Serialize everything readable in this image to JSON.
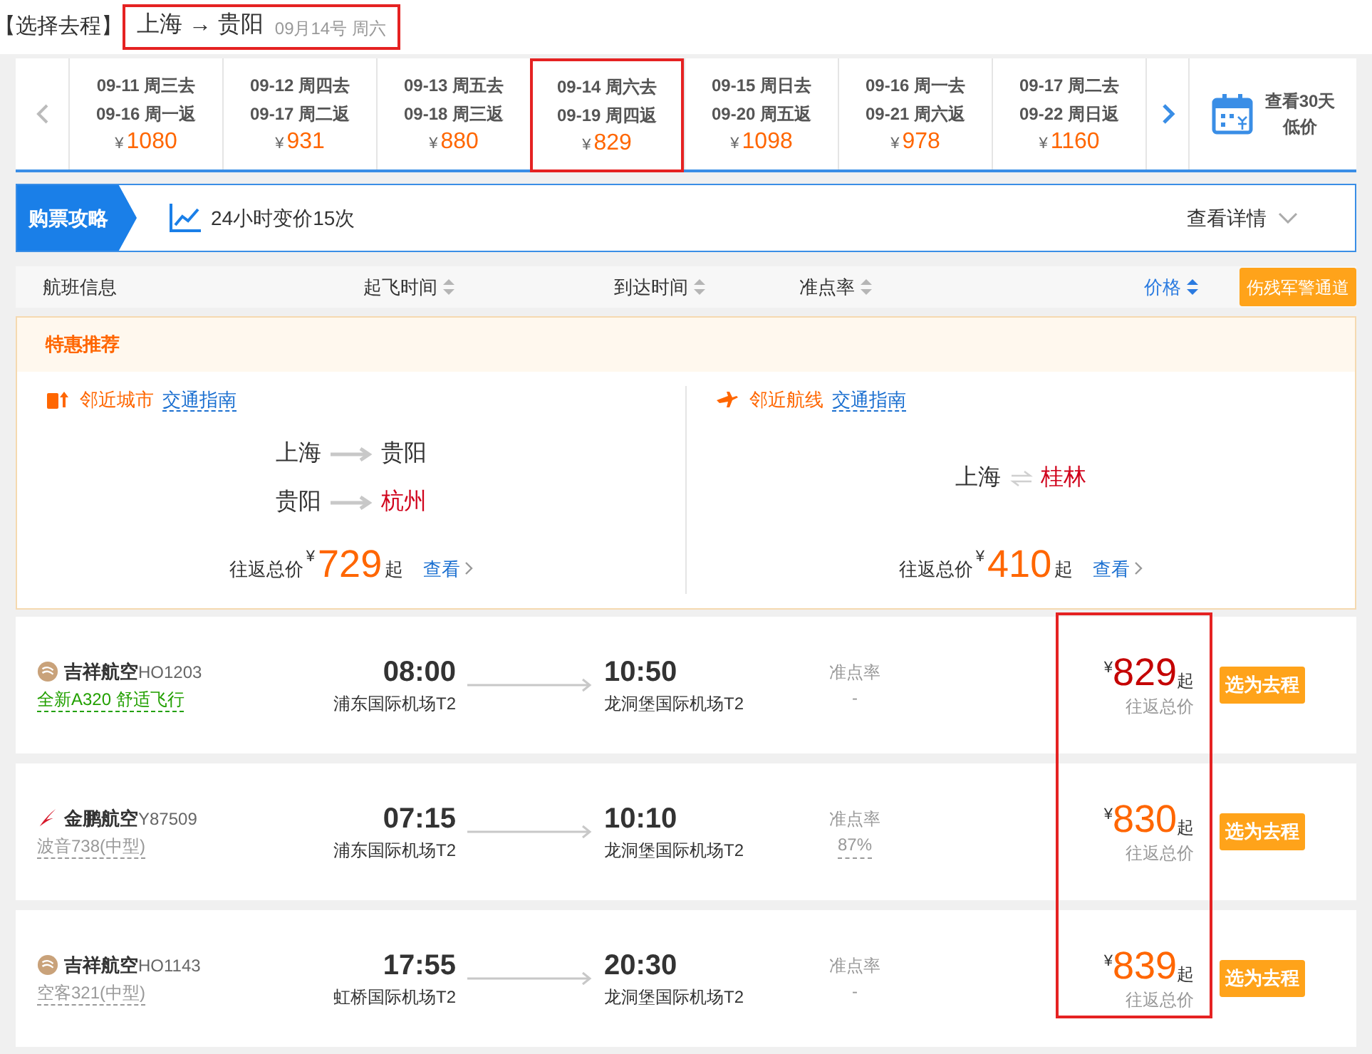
{
  "header": {
    "bracket_title": "【选择去程】",
    "route": "上海 → 贵阳",
    "date": "09月14号 周六"
  },
  "date_tabs": [
    {
      "depart": "09-11 周三去",
      "return": "09-16 周一返",
      "currency": "¥",
      "price": "1080",
      "selected": false
    },
    {
      "depart": "09-12 周四去",
      "return": "09-17 周二返",
      "currency": "¥",
      "price": "931",
      "selected": false
    },
    {
      "depart": "09-13 周五去",
      "return": "09-18 周三返",
      "currency": "¥",
      "price": "880",
      "selected": false
    },
    {
      "depart": "09-14 周六去",
      "return": "09-19 周四返",
      "currency": "¥",
      "price": "829",
      "selected": true
    },
    {
      "depart": "09-15 周日去",
      "return": "09-20 周五返",
      "currency": "¥",
      "price": "1098",
      "selected": false
    },
    {
      "depart": "09-16 周一去",
      "return": "09-21 周六返",
      "currency": "¥",
      "price": "978",
      "selected": false
    },
    {
      "depart": "09-17 周二去",
      "return": "09-22 周日返",
      "currency": "¥",
      "price": "1160",
      "selected": false
    }
  ],
  "calendar_link": [
    "查看30天",
    "低价"
  ],
  "guide": {
    "label": "购票攻略",
    "trend": "24小时变价15次",
    "details": "查看详情"
  },
  "sort_header": {
    "columns": [
      {
        "label": "航班信息",
        "sortable": false,
        "selected": false
      },
      {
        "label": "起飞时间",
        "sortable": true,
        "selected": false
      },
      {
        "label": "到达时间",
        "sortable": true,
        "selected": false
      },
      {
        "label": "准点率",
        "sortable": true,
        "selected": false
      },
      {
        "label": "价格",
        "sortable": true,
        "selected": true
      }
    ],
    "button": "伤残军警通道"
  },
  "recommend": {
    "title": "特惠推荐",
    "cards": [
      {
        "kind": "city",
        "tag": "邻近城市",
        "link": "交通指南",
        "routes": [
          {
            "from": "上海",
            "to": "贵阳",
            "to_highlight": false
          },
          {
            "from": "贵阳",
            "to": "杭州",
            "to_highlight": true
          }
        ],
        "price_label": "往返总价",
        "currency": "¥",
        "price": "729",
        "suffix": "起",
        "view": "查看"
      },
      {
        "kind": "route",
        "tag": "邻近航线",
        "link": "交通指南",
        "routes": [
          {
            "from": "上海",
            "to": "桂林",
            "to_highlight": true
          }
        ],
        "price_label": "往返总价",
        "currency": "¥",
        "price": "410",
        "suffix": "起",
        "view": "查看"
      }
    ]
  },
  "flights": [
    {
      "kind": "round",
      "airline": "吉祥航空",
      "flight_no": "HO1203",
      "aircraft": "全新A320 舒适飞行",
      "aircraft_green": true,
      "depart_time": "08:00",
      "depart_airport": "浦东国际机场T2",
      "arrive_time": "10:50",
      "arrive_airport": "龙洞堡国际机场T2",
      "ontime_label": "准点率",
      "ontime": "-",
      "currency": "¥",
      "price": "829",
      "suffix": "起",
      "price_label": "往返总价",
      "lowest": true,
      "button": "选为去程"
    },
    {
      "kind": "wing",
      "airline": "金鹏航空",
      "flight_no": "Y87509",
      "aircraft": "波音738(中型)",
      "aircraft_green": false,
      "depart_time": "07:15",
      "depart_airport": "浦东国际机场T2",
      "arrive_time": "10:10",
      "arrive_airport": "龙洞堡国际机场T2",
      "ontime_label": "准点率",
      "ontime": "87%",
      "currency": "¥",
      "price": "830",
      "suffix": "起",
      "price_label": "往返总价",
      "lowest": false,
      "button": "选为去程"
    },
    {
      "kind": "round",
      "airline": "吉祥航空",
      "flight_no": "HO1143",
      "aircraft": "空客321(中型)",
      "aircraft_green": false,
      "depart_time": "17:55",
      "depart_airport": "虹桥国际机场T2",
      "arrive_time": "20:30",
      "arrive_airport": "龙洞堡国际机场T2",
      "ontime_label": "准点率",
      "ontime": "-",
      "currency": "¥",
      "price": "839",
      "suffix": "起",
      "price_label": "往返总价",
      "lowest": false,
      "button": "选为去程"
    }
  ]
}
